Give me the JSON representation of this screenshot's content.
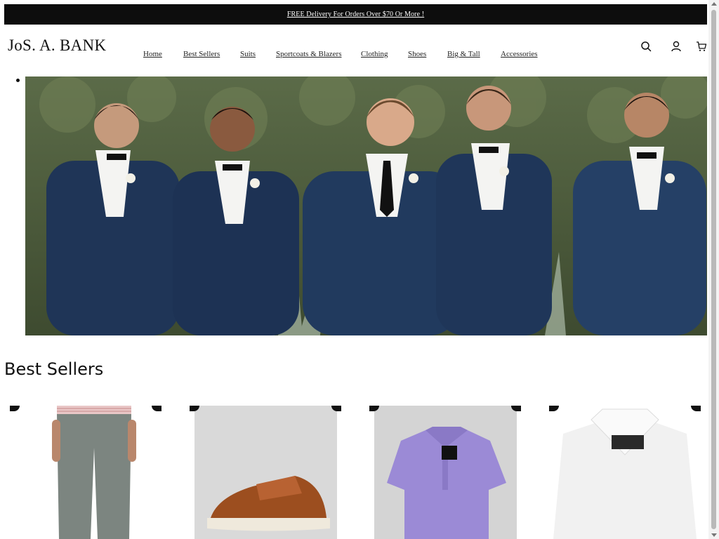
{
  "promo": {
    "text": "FREE Delivery For Orders Over $70 Or More !"
  },
  "brand": {
    "logo_text": "JoS. A. BANK"
  },
  "nav": {
    "items": [
      {
        "label": "Home"
      },
      {
        "label": "Best Sellers"
      },
      {
        "label": "Suits"
      },
      {
        "label": "Sportcoats & Blazers"
      },
      {
        "label": "Clothing"
      },
      {
        "label": "Shoes"
      },
      {
        "label": "Big & Tall"
      },
      {
        "label": "Accessories"
      }
    ]
  },
  "header_icons": [
    {
      "name": "search-icon"
    },
    {
      "name": "account-icon"
    },
    {
      "name": "cart-icon"
    }
  ],
  "hero": {
    "image": "five-groomsmen-navy-tuxedos-photo",
    "colors": {
      "suit": "#1f3557",
      "foliage": "#4c5c3a",
      "shirt": "#f4f4f2"
    }
  },
  "best_sellers": {
    "title": "Best Sellers",
    "products": [
      {
        "image": "grey-dress-pants-photo"
      },
      {
        "image": "brown-leather-sneaker-photo"
      },
      {
        "image": "purple-polo-shirt-photo"
      },
      {
        "image": "white-dress-shirt-photo"
      }
    ]
  }
}
